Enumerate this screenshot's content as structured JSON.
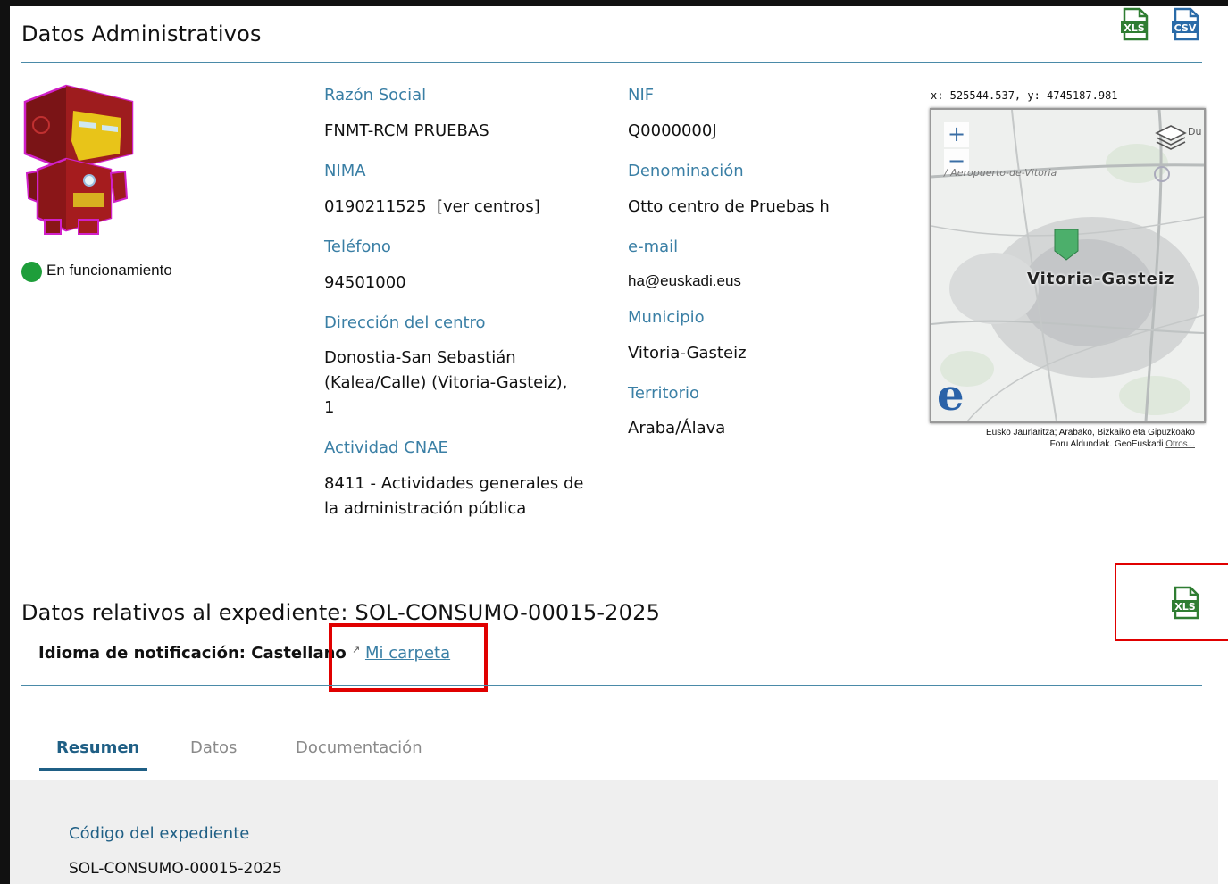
{
  "admin": {
    "title": "Datos Administrativos",
    "status_text": "En funcionamiento",
    "status_color": "#1e9e3a",
    "export_buttons": [
      {
        "label": "XLS",
        "icon": "xls-file-icon"
      },
      {
        "label": "CSV",
        "icon": "csv-file-icon"
      }
    ],
    "fields": {
      "razon_social_label": "Razón Social",
      "razon_social_value": "FNMT-RCM PRUEBAS",
      "nima_label": "NIMA",
      "nima_value": "0190211525",
      "nima_link_open": "[",
      "nima_link": "ver centros",
      "nima_link_close": "]",
      "telefono_label": "Teléfono",
      "telefono_value": "94501000",
      "direccion_label": "Dirección del centro",
      "direccion_line1": "Donostia-San Sebastián",
      "direccion_line2": "(Kalea/Calle) (Vitoria-Gasteiz),",
      "direccion_line3": "1",
      "actividad_label": "Actividad CNAE",
      "actividad_line1": "8411 - Actividades generales de",
      "actividad_line2": "la administración pública",
      "nif_label": "NIF",
      "nif_value": "Q0000000J",
      "denominacion_label": "Denominación",
      "denominacion_value": "Otto centro de Pruebas h",
      "email_label": "e-mail",
      "email_value": "ha@euskadi.eus",
      "municipio_label": "Municipio",
      "municipio_value": "Vitoria-Gasteiz",
      "territorio_label": "Territorio",
      "territorio_value": "Araba/Álava"
    },
    "map": {
      "coords": "x: 525544.537, y: 4745187.981",
      "city_label": "Vitoria-Gasteiz",
      "airport_label": "/ Aeropuerto-de-Vitoria",
      "zoom_in": "+",
      "zoom_out": "−",
      "layer_partial": "Du",
      "logo": "e",
      "attribution_line1": "Eusko Jaurlaritza; Arabako, Bizkaiko eta Gipuzkoako",
      "attribution_line2": "Foru Aldundiak. GeoEuskadi",
      "attribution_link": "Otros..."
    }
  },
  "expediente": {
    "title": "Datos relativos al expediente: SOL-CONSUMO-00015-2025",
    "idioma": "Idioma de notificación: Castellano",
    "mi_carpeta": "Mi carpeta",
    "xls_label": "XLS",
    "highlight_color": "#e00000"
  },
  "tabs": [
    {
      "label": "Resumen",
      "active": true
    },
    {
      "label": "Datos",
      "active": false
    },
    {
      "label": "Documentación",
      "active": false
    }
  ],
  "resumen": {
    "codigo_label": "Código del expediente",
    "codigo_value": "SOL-CONSUMO-00015-2025"
  }
}
